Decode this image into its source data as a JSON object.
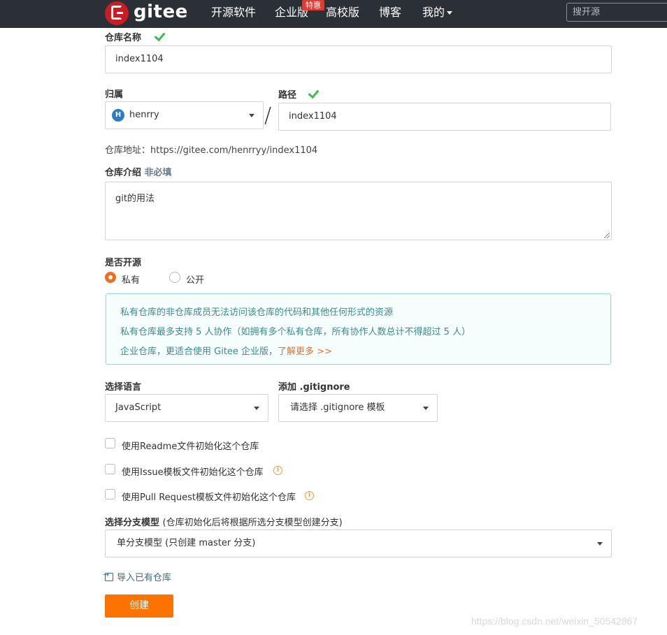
{
  "nav": {
    "brand": "gitee",
    "items": [
      {
        "label": "开源软件"
      },
      {
        "label": "企业版"
      },
      {
        "label": "高校版"
      },
      {
        "label": "博客"
      },
      {
        "label": "我的"
      }
    ],
    "badge": "特惠",
    "search_placeholder": "搜开源"
  },
  "form": {
    "repo_name_label": "仓库名称",
    "repo_name_value": "index1104",
    "owner_label": "归属",
    "owner_avatar": "H",
    "owner_value": "henrry",
    "slash": "/",
    "path_label": "路径",
    "path_value": "index1104",
    "repo_url": "仓库地址：https://gitee.com/henrryy/index1104",
    "intro_label": "仓库介绍",
    "intro_optional": "非必填",
    "intro_value": "git的用法",
    "open_label": "是否开源",
    "visibility_options": [
      {
        "label": "私有",
        "selected": true
      },
      {
        "label": "公开",
        "selected": false
      }
    ],
    "notice": {
      "line1": "私有仓库的非仓库成员无法访问该仓库的代码和其他任何形式的资源",
      "line2": "私有仓库最多支持 5 人协作（如拥有多个私有仓库，所有协作人数总计不得超过 5 人）",
      "line3": "企业仓库，更适合使用 Gitee 企业版，",
      "link": "了解更多 >>"
    },
    "language_label": "选择语言",
    "language_value": "JavaScript",
    "gitignore_label": "添加 .gitignore",
    "gitignore_value": "请选择 .gitignore 模板",
    "init_options": [
      {
        "label": "使用Readme文件初始化这个仓库",
        "checked": false
      },
      {
        "label": "使用Issue模板文件初始化这个仓库",
        "checked": false
      },
      {
        "label": "使用Pull Request模板文件初始化这个仓库",
        "checked": false
      }
    ],
    "branch_label": "选择分支模型",
    "branch_hint": "(仓库初始化后将根据所选分支模型创建分支)",
    "branch_value": "单分支模型 (只创建 master 分支)",
    "import_label": "导入已有仓库",
    "create_button": "创建"
  },
  "watermark": "https://blog.csdn.net/weixin_50542867",
  "colors": {
    "navbar": "#2b2f36",
    "brand_red": "#c71d23",
    "accent_orange": "#fe7300",
    "check_green": "#3fb950",
    "notice_text": "#3d8a8e"
  }
}
